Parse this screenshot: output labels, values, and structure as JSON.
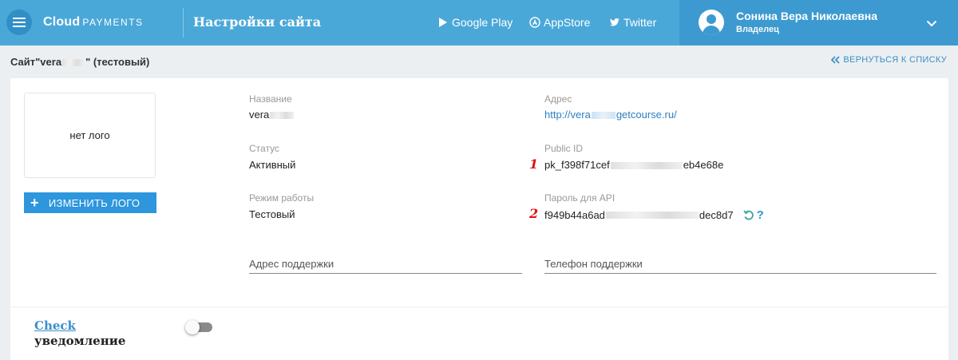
{
  "header": {
    "logo_bold": "Cloud",
    "logo_light": "PAYMENTS",
    "title": "Настройки сайта",
    "links": {
      "google_play": "Google Play",
      "appstore": "AppStore",
      "twitter": "Twitter"
    },
    "user": {
      "name": "Сонина Вера Николаевна",
      "role": "Владелец"
    }
  },
  "subheader": {
    "site_prefix": "Сайт\"vera",
    "site_suffix": "\" (тестовый)",
    "back_link": "ВЕРНУТЬСЯ К СПИСКУ"
  },
  "logo": {
    "placeholder": "нет лого",
    "change_button": "ИЗМЕНИТЬ ЛОГО"
  },
  "fields": {
    "name_label": "Название",
    "name_value": "vera",
    "address_label": "Адрес",
    "address_prefix": "http://vera",
    "address_suffix": "getcourse.ru/",
    "status_label": "Статус",
    "status_value": "Активный",
    "public_id_label": "Public ID",
    "public_id_prefix": "pk_f398f71cef",
    "public_id_suffix": "eb4e68e",
    "mode_label": "Режим работы",
    "mode_value": "Тестовый",
    "api_pass_label": "Пароль для API",
    "api_pass_prefix": "f949b44a6ad",
    "api_pass_suffix": "dec8d7",
    "help_mark": "?",
    "support_address_placeholder": "Адрес поддержки",
    "support_phone_placeholder": "Телефон поддержки"
  },
  "markers": {
    "one": "1",
    "two": "2"
  },
  "check": {
    "link": "Check",
    "sub": "уведомление",
    "enabled": false
  },
  "colors": {
    "header_bg": "#4aa8d8",
    "user_bg": "#3d9ad0",
    "accent": "#2d96dd",
    "link": "#2d7fc2",
    "marker": "#dd1111"
  },
  "icons": [
    "menu-icon",
    "google-play-icon",
    "appstore-icon",
    "twitter-icon",
    "avatar-icon",
    "chevron-down-icon",
    "double-chevron-left-icon",
    "plus-icon",
    "refresh-icon",
    "help-icon"
  ]
}
